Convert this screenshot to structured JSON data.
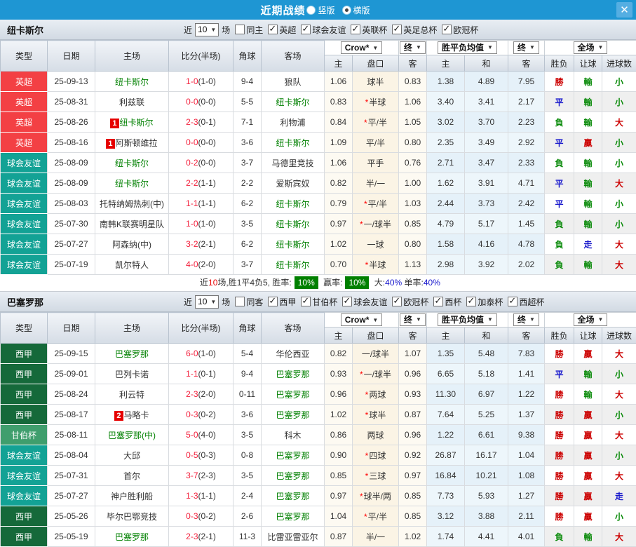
{
  "colors": {
    "titlebar_blue": "#1e96d3",
    "score_red": "#f3203c",
    "focal_team_green": "#008000",
    "summary_badge_green": "#008000",
    "type_badges": {
      "英超": "#f34044",
      "球会友谊": "#13a295",
      "西甲": "#15693a",
      "甘伯杯": "#3f9e6d"
    },
    "result_text": {
      "勝": "#cc0000",
      "贏": "#cc0000",
      "大": "#cc0000",
      "平": "#1717cc",
      "走": "#1717cc",
      "負": "#098a09",
      "輸": "#098a09",
      "小": "#098a09"
    }
  },
  "titlebar": {
    "title": "近期战绩",
    "vertical_label": "竖版",
    "horizontal_label": "横版",
    "vertical_checked": false,
    "horizontal_checked": true,
    "close_glyph": "✕"
  },
  "header": {
    "left_cols": [
      "类型",
      "日期",
      "主场",
      "比分(半场)",
      "角球",
      "客场"
    ],
    "dropdowns": [
      {
        "label": "Crow*",
        "span": 2
      },
      {
        "label": "终",
        "span": 1
      },
      {
        "label": "胜平负均值",
        "span": 2
      },
      {
        "label": "终",
        "span": 1
      },
      {
        "label": "全场",
        "span": 3
      }
    ],
    "sub_cols": [
      "主",
      "盘口",
      "客",
      "主",
      "和",
      "客",
      "胜负",
      "让球",
      "进球数"
    ]
  },
  "sections": [
    {
      "team": "纽卡斯尔",
      "filter": {
        "prefix": "近",
        "count": "10",
        "suffix": "场",
        "same_label": "同主",
        "same_checked": false,
        "leagues": [
          {
            "label": "英超",
            "checked": true
          },
          {
            "label": "球会友谊",
            "checked": true
          },
          {
            "label": "英联杯",
            "checked": true
          },
          {
            "label": "英足总杯",
            "checked": true
          },
          {
            "label": "欧冠杯",
            "checked": true
          }
        ]
      },
      "rows": [
        {
          "type": "英超",
          "date": "25-09-13",
          "home": "纽卡斯尔",
          "home_green": true,
          "away": "狼队",
          "score": "1-0",
          "half": "(1-0)",
          "corner": "9-4",
          "odds": [
            "1.06",
            "球半",
            "0.83"
          ],
          "star": false,
          "avg": [
            "1.38",
            "4.89",
            "7.95"
          ],
          "outcome": [
            "勝",
            "輸",
            "小"
          ]
        },
        {
          "type": "英超",
          "date": "25-08-31",
          "home": "利兹联",
          "away": "纽卡斯尔",
          "away_green": true,
          "score": "0-0",
          "half": "(0-0)",
          "corner": "5-5",
          "odds": [
            "0.83",
            "半球",
            "1.06"
          ],
          "star": true,
          "avg": [
            "3.40",
            "3.41",
            "2.17"
          ],
          "outcome": [
            "平",
            "輸",
            "小"
          ]
        },
        {
          "type": "英超",
          "date": "25-08-26",
          "home": "纽卡斯尔",
          "home_badge": "1",
          "home_green": true,
          "away": "利物浦",
          "score": "2-3",
          "half": "(0-1)",
          "corner": "7-1",
          "odds": [
            "0.84",
            "平/半",
            "1.05"
          ],
          "star": true,
          "avg": [
            "3.02",
            "3.70",
            "2.23"
          ],
          "outcome": [
            "負",
            "輸",
            "大"
          ]
        },
        {
          "type": "英超",
          "date": "25-08-16",
          "home": "阿斯顿维拉",
          "home_badge": "1",
          "away": "纽卡斯尔",
          "away_green": true,
          "score": "0-0",
          "half": "(0-0)",
          "corner": "3-6",
          "odds": [
            "1.09",
            "平/半",
            "0.80"
          ],
          "star": false,
          "avg": [
            "2.35",
            "3.49",
            "2.92"
          ],
          "outcome": [
            "平",
            "贏",
            "小"
          ]
        },
        {
          "type": "球会友谊",
          "date": "25-08-09",
          "home": "纽卡斯尔",
          "home_green": true,
          "away": "马德里竞技",
          "score": "0-2",
          "half": "(0-0)",
          "corner": "3-7",
          "odds": [
            "1.06",
            "平手",
            "0.76"
          ],
          "star": false,
          "avg": [
            "2.71",
            "3.47",
            "2.33"
          ],
          "outcome": [
            "負",
            "輸",
            "小"
          ]
        },
        {
          "type": "球会友谊",
          "date": "25-08-09",
          "home": "纽卡斯尔",
          "home_green": true,
          "away": "爱斯宾奴",
          "score": "2-2",
          "half": "(1-1)",
          "corner": "2-2",
          "odds": [
            "0.82",
            "半/一",
            "1.00"
          ],
          "star": false,
          "avg": [
            "1.62",
            "3.91",
            "4.71"
          ],
          "outcome": [
            "平",
            "輸",
            "大"
          ]
        },
        {
          "type": "球会友谊",
          "date": "25-08-03",
          "home": "托特纳姆热刺(中)",
          "away": "纽卡斯尔",
          "away_green": true,
          "score": "1-1",
          "half": "(1-1)",
          "corner": "6-2",
          "odds": [
            "0.79",
            "平/半",
            "1.03"
          ],
          "star": true,
          "avg": [
            "2.44",
            "3.73",
            "2.42"
          ],
          "outcome": [
            "平",
            "輸",
            "小"
          ]
        },
        {
          "type": "球会友谊",
          "date": "25-07-30",
          "home": "南韩K联赛明星队",
          "away": "纽卡斯尔",
          "away_green": true,
          "score": "1-0",
          "half": "(1-0)",
          "corner": "3-5",
          "odds": [
            "0.97",
            "一/球半",
            "0.85"
          ],
          "star": true,
          "avg": [
            "4.79",
            "5.17",
            "1.45"
          ],
          "outcome": [
            "負",
            "輸",
            "小"
          ]
        },
        {
          "type": "球会友谊",
          "date": "25-07-27",
          "home": "阿森纳(中)",
          "away": "纽卡斯尔",
          "away_green": true,
          "score": "3-2",
          "half": "(2-1)",
          "corner": "6-2",
          "odds": [
            "1.02",
            "一球",
            "0.80"
          ],
          "star": false,
          "avg": [
            "1.58",
            "4.16",
            "4.78"
          ],
          "outcome": [
            "負",
            "走",
            "大"
          ]
        },
        {
          "type": "球会友谊",
          "date": "25-07-19",
          "home": "凯尔特人",
          "away": "纽卡斯尔",
          "away_green": true,
          "score": "4-0",
          "half": "(2-0)",
          "corner": "3-7",
          "odds": [
            "0.70",
            "半球",
            "1.13"
          ],
          "star": true,
          "avg": [
            "2.98",
            "3.92",
            "2.02"
          ],
          "outcome": [
            "負",
            "輸",
            "大"
          ]
        }
      ],
      "summary_parts": [
        {
          "t": "近",
          "c": ""
        },
        {
          "t": "10",
          "c": "red"
        },
        {
          "t": "场,胜1平4负5, 胜率:",
          "c": ""
        },
        {
          "t": "10%",
          "c": "badge"
        },
        {
          "t": " 赢率:",
          "c": ""
        },
        {
          "t": "10%",
          "c": "badge"
        },
        {
          "t": " 大:",
          "c": ""
        },
        {
          "t": "40%",
          "c": "blue"
        },
        {
          "t": " 单率:",
          "c": ""
        },
        {
          "t": "40%",
          "c": "blue"
        }
      ]
    },
    {
      "team": "巴塞罗那",
      "filter": {
        "prefix": "近",
        "count": "10",
        "suffix": "场",
        "same_label": "同客",
        "same_checked": false,
        "leagues": [
          {
            "label": "西甲",
            "checked": true
          },
          {
            "label": "甘伯杯",
            "checked": true
          },
          {
            "label": "球会友谊",
            "checked": true
          },
          {
            "label": "欧冠杯",
            "checked": true
          },
          {
            "label": "西杯",
            "checked": true
          },
          {
            "label": "加泰杯",
            "checked": true
          },
          {
            "label": "西超杯",
            "checked": true
          }
        ]
      },
      "rows": [
        {
          "type": "西甲",
          "date": "25-09-15",
          "home": "巴塞罗那",
          "home_green": true,
          "away": "华伦西亚",
          "score": "6-0",
          "half": "(1-0)",
          "corner": "5-4",
          "odds": [
            "0.82",
            "一/球半",
            "1.07"
          ],
          "star": false,
          "avg": [
            "1.35",
            "5.48",
            "7.83"
          ],
          "outcome": [
            "勝",
            "贏",
            "大"
          ]
        },
        {
          "type": "西甲",
          "date": "25-09-01",
          "home": "巴列卡诺",
          "away": "巴塞罗那",
          "away_green": true,
          "score": "1-1",
          "half": "(0-1)",
          "corner": "9-4",
          "odds": [
            "0.93",
            "一/球半",
            "0.96"
          ],
          "star": true,
          "avg": [
            "6.65",
            "5.18",
            "1.41"
          ],
          "outcome": [
            "平",
            "輸",
            "小"
          ]
        },
        {
          "type": "西甲",
          "date": "25-08-24",
          "home": "利云特",
          "away": "巴塞罗那",
          "away_green": true,
          "score": "2-3",
          "half": "(2-0)",
          "corner": "0-11",
          "odds": [
            "0.96",
            "两球",
            "0.93"
          ],
          "star": true,
          "avg": [
            "11.30",
            "6.97",
            "1.22"
          ],
          "outcome": [
            "勝",
            "輸",
            "大"
          ]
        },
        {
          "type": "西甲",
          "date": "25-08-17",
          "home": "马略卡",
          "home_badge": "2",
          "away": "巴塞罗那",
          "away_green": true,
          "score": "0-3",
          "half": "(0-2)",
          "corner": "3-6",
          "odds": [
            "1.02",
            "球半",
            "0.87"
          ],
          "star": true,
          "avg": [
            "7.64",
            "5.25",
            "1.37"
          ],
          "outcome": [
            "勝",
            "贏",
            "小"
          ]
        },
        {
          "type": "甘伯杯",
          "date": "25-08-11",
          "home": "巴塞罗那(中)",
          "home_green": true,
          "away": "科木",
          "score": "5-0",
          "half": "(4-0)",
          "corner": "3-5",
          "odds": [
            "0.86",
            "两球",
            "0.96"
          ],
          "star": false,
          "avg": [
            "1.22",
            "6.61",
            "9.38"
          ],
          "outcome": [
            "勝",
            "贏",
            "大"
          ]
        },
        {
          "type": "球会友谊",
          "date": "25-08-04",
          "home": "大邱",
          "away": "巴塞罗那",
          "away_green": true,
          "score": "0-5",
          "half": "(0-3)",
          "corner": "0-8",
          "odds": [
            "0.90",
            "四球",
            "0.92"
          ],
          "star": true,
          "avg": [
            "26.87",
            "16.17",
            "1.04"
          ],
          "outcome": [
            "勝",
            "贏",
            "小"
          ]
        },
        {
          "type": "球会友谊",
          "date": "25-07-31",
          "home": "首尔",
          "away": "巴塞罗那",
          "away_green": true,
          "score": "3-7",
          "half": "(2-3)",
          "corner": "3-5",
          "odds": [
            "0.85",
            "三球",
            "0.97"
          ],
          "star": true,
          "avg": [
            "16.84",
            "10.21",
            "1.08"
          ],
          "outcome": [
            "勝",
            "贏",
            "大"
          ]
        },
        {
          "type": "球会友谊",
          "date": "25-07-27",
          "home": "神户胜利船",
          "away": "巴塞罗那",
          "away_green": true,
          "score": "1-3",
          "half": "(1-1)",
          "corner": "2-4",
          "odds": [
            "0.97",
            "球半/两",
            "0.85"
          ],
          "star": true,
          "avg": [
            "7.73",
            "5.93",
            "1.27"
          ],
          "outcome": [
            "勝",
            "贏",
            "走"
          ]
        },
        {
          "type": "西甲",
          "date": "25-05-26",
          "home": "毕尔巴鄂竞技",
          "away": "巴塞罗那",
          "away_green": true,
          "score": "0-3",
          "half": "(0-2)",
          "corner": "2-6",
          "odds": [
            "1.04",
            "平/半",
            "0.85"
          ],
          "star": true,
          "avg": [
            "3.12",
            "3.88",
            "2.11"
          ],
          "outcome": [
            "勝",
            "贏",
            "小"
          ]
        },
        {
          "type": "西甲",
          "date": "25-05-19",
          "home": "巴塞罗那",
          "home_green": true,
          "away": "比雷亚雷亚尔",
          "score": "2-3",
          "half": "(2-1)",
          "corner": "11-3",
          "odds": [
            "0.87",
            "半/一",
            "1.02"
          ],
          "star": false,
          "avg": [
            "1.74",
            "4.41",
            "4.01"
          ],
          "outcome": [
            "負",
            "輸",
            "大"
          ]
        }
      ],
      "summary_parts": []
    }
  ]
}
